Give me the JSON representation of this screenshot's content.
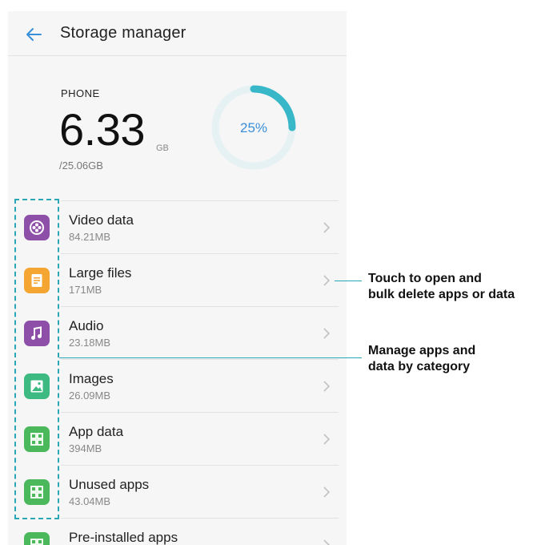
{
  "header": {
    "title": "Storage manager",
    "back_icon": "arrow-left-icon"
  },
  "storage": {
    "label": "PHONE",
    "used": "6.33",
    "unit": "GB",
    "total": "/25.06GB",
    "percent_text": "25%",
    "percent_value": 0.25,
    "ring_color": "#38b7c9",
    "ring_track": "#e6f1f4"
  },
  "categories": [
    {
      "label": "Video data",
      "size": "84.21MB",
      "icon": "video-reel-icon",
      "color": "#8e4fa8"
    },
    {
      "label": "Large files",
      "size": "171MB",
      "icon": "document-icon",
      "color": "#f4a532"
    },
    {
      "label": "Audio",
      "size": "23.18MB",
      "icon": "music-note-icon",
      "color": "#8e4fa8"
    },
    {
      "label": "Images",
      "size": "26.09MB",
      "icon": "image-icon",
      "color": "#3dba82"
    },
    {
      "label": "App data",
      "size": "394MB",
      "icon": "app-grid-icon",
      "color": "#4cb85c"
    },
    {
      "label": "Unused apps",
      "size": "43.04MB",
      "icon": "app-grid-icon",
      "color": "#4cb85c"
    },
    {
      "label": "Pre-installed apps",
      "size": "",
      "icon": "app-grid-icon",
      "color": "#4cb85c"
    }
  ],
  "callouts": {
    "open_line1": "Touch to open and",
    "open_line2": "bulk delete apps or data",
    "manage_line1": "Manage apps and",
    "manage_line2": "data by category",
    "color": "#2aa6b7"
  }
}
